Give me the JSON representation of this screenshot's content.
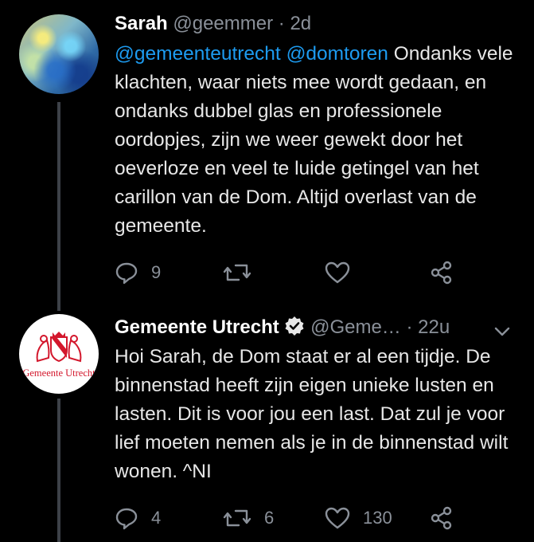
{
  "tweets": [
    {
      "author": {
        "name": "Sarah",
        "handle": "@geemmer",
        "avatar": "abstract-painting-avatar"
      },
      "time": "2d",
      "mentions": [
        "@gemeenteutrecht",
        "@domtoren"
      ],
      "text": "Ondanks vele klachten, waar niets mee wordt gedaan, en ondanks dubbel glas en professionele oordopjes, zijn we weer gewekt door het oeverloze en veel te luide getingel van het carillon van de Dom. Altijd overlast van de gemeente.",
      "replies": "9",
      "retweets": "",
      "likes": ""
    },
    {
      "author": {
        "name": "Gemeente Utrecht",
        "handle": "@Geme…",
        "verified": true,
        "avatar_text": "Gemeente Utrecht"
      },
      "time": "22u",
      "text": "Hoi Sarah, de Dom staat er al een tijdje. De binnenstad heeft zijn eigen unieke lusten en lasten. Dit is voor jou een last. Dat zul je voor lief moeten nemen als je in de binnenstad wilt wonen. ^NI",
      "replies": "4",
      "retweets": "6",
      "likes": "130"
    }
  ],
  "colors": {
    "background": "#000000",
    "link": "#1d9bf0",
    "muted": "#8a9099",
    "brand_red": "#d3172c"
  }
}
